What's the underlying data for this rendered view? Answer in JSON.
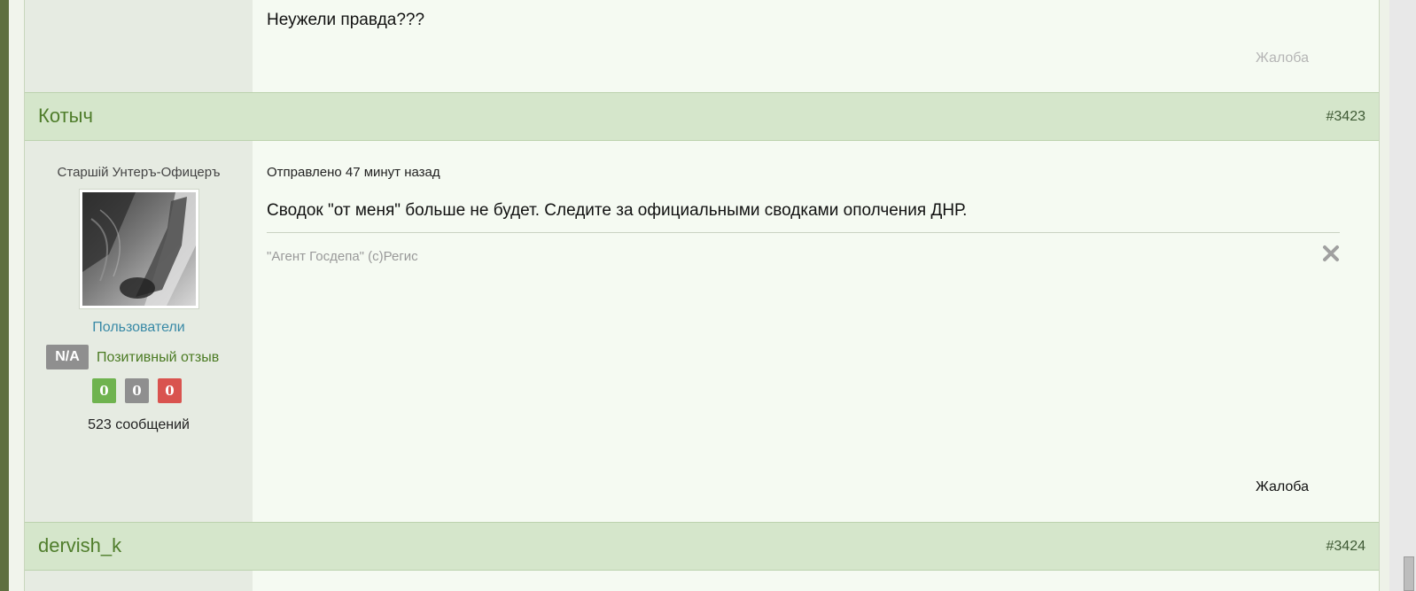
{
  "prev_post": {
    "text": "Неужели правда???",
    "complaint_label": "Жалоба"
  },
  "post_3423": {
    "author": "Котыч",
    "number": "#3423",
    "rank": "Старшій Унтеръ-Офицеръ",
    "group": "Пользователи",
    "rating_badge": "N/A",
    "rating_label": "Позитивный отзыв",
    "counts": {
      "positive": "0",
      "neutral": "0",
      "negative": "0"
    },
    "message_count": "523 сообщений",
    "sent": "Отправлено 47 минут назад",
    "text": "Сводок \"от меня\" больше не будет. Следите за официальными сводками ополчения ДНР.",
    "signature": "\"Агент Госдепа\" (с)Регис",
    "complaint_label": "Жалоба"
  },
  "post_3424": {
    "author": "dervish_k",
    "number": "#3424"
  },
  "colors": {
    "header_bg": "#d5e6cb",
    "author_green": "#4f7d2b",
    "link_blue": "#3889a6",
    "positive_green": "#6fb34f",
    "neutral_gray": "#8f8f8f",
    "negative_red": "#d9534f"
  }
}
